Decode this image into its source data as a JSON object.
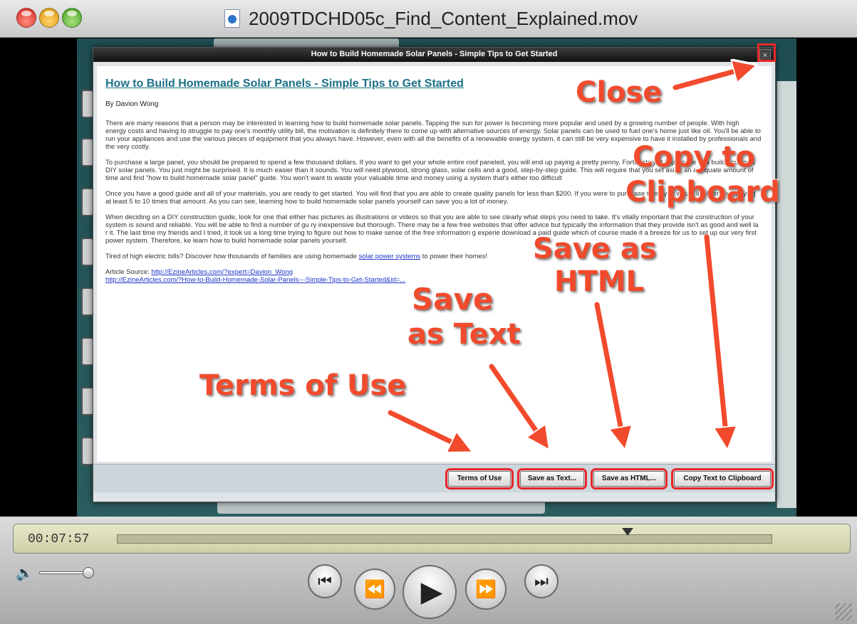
{
  "window": {
    "title": "2009TDCHD05c_Find_Content_Explained.mov"
  },
  "dialog": {
    "title": "How to Build Homemade Solar Panels - Simple Tips to Get Started",
    "close_glyph": "×",
    "article": {
      "headline": "How to Build Homemade Solar Panels - Simple Tips to Get Started",
      "byline": "By Davion Wong",
      "paragraphs": [
        "There are many reasons that a person may be interested in learning how to build homemade solar panels.  Tapping the sun for power is becoming more popular and used by a growing number of people. With high energy costs and having to struggle to pay one's monthly utility bill, the motivation is definitely there to come up with alternative sources of energy.  Solar panels can be used to fuel one's home just like oil. You'll be able to run your appliances and use the various pieces of equipment that you always have. However, even with all the benefits of a renewable energy system, it can still be very expensive to have it installed by professionals and the very costly.",
        "To purchase a large panel, you should be prepared to spend a few thousand dollars.  If you want to get your whole entire roof paneled, you will end up paying a pretty penny. Fortunately, it is possible to a build your own DIY solar panels. You just might be surprised. It is much easier than it sounds.  You will need plywood, strong glass, solar cells and a good, step-by-step guide. This will require that you set aside an adequate amount of time and find \"how to build homemade solar panel\" guide. You won't want to waste your valuable time and money using a system that's either too difficult",
        "Once you have a good guide and all of your materials, you are ready to get started. You will find that you are able to create quality panels for less than $200.  If you were to purchase them you would likely end up paying at least 5 to 10 times that amount.  As you can see, learning how to build homemade solar panels yourself can save you a lot of money.",
        "When deciding on a DIY construction guide, look for one that either has pictures as illustrations or videos so that you are able to see clearly what steps you need to take.  It's vitally important that the construction of your system is sound and reliable.  You will be able to find a number of gu                  ry inexpensive but thorough.  There may be a few free websites that offer advice but typically the information that they provide isn't as good and well la                  r it. The last time my friends and I tried, it took us a long time trying to figure out how to make sense of the free information                  g experie                  download a paid guide which of course made it a breeze for us to set up our very first power system. Therefore, ke                  learn how to build homemade solar panels yourself."
      ],
      "closing_prefix": "Tired of high electric bills? Discover how thousands of families are using homemade ",
      "closing_link": "solar power systems",
      "closing_suffix": " to power their homes!",
      "source_label": "Article Source: ",
      "source_link_1": "http://EzineArticles.com/?expert=Davion_Wong",
      "source_link_2": "http://EzineArticles.com/?How-to-Build-Homemade-Solar-Panels---Simple-Tips-to-Get-Started&id=..."
    },
    "buttons": {
      "terms": "Terms of Use",
      "save_text": "Save as Text...",
      "save_html": "Save as HTML...",
      "copy": "Copy Text to Clipboard"
    }
  },
  "annotations": {
    "close": "Close",
    "copy_line1": "Copy to",
    "copy_line2": "Clipboard",
    "save_html_line1": "Save as",
    "save_html_line2": "HTML",
    "save_text_line1": "Save",
    "save_text_line2": "as Text",
    "terms": "Terms of Use",
    "color": "#f24a2c"
  },
  "player": {
    "timecode": "00:07:57",
    "playhead_fraction": 0.78,
    "volume_fraction": 1.0,
    "icons": [
      "volume-icon",
      "skip-to-start-icon",
      "rewind-icon",
      "play-icon",
      "fast-forward-icon",
      "skip-to-end-icon"
    ]
  }
}
